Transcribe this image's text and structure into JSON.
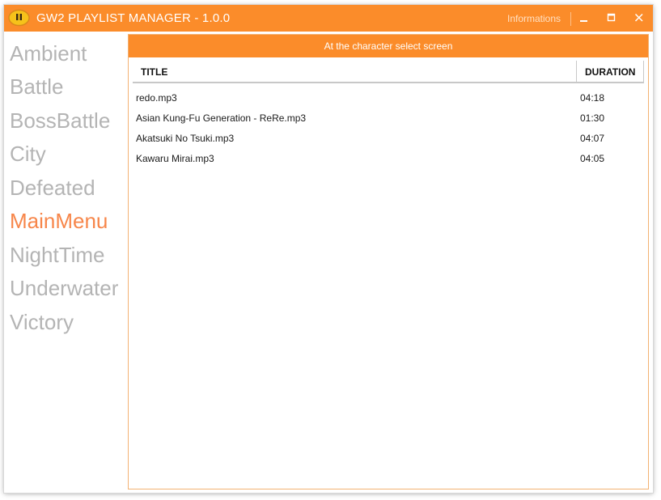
{
  "window": {
    "title": "GW2 PLAYLIST MANAGER - 1.0.0",
    "info_label": "Informations",
    "accent_color": "#fb8c2a"
  },
  "sidebar": {
    "items": [
      {
        "label": "Ambient",
        "active": false
      },
      {
        "label": "Battle",
        "active": false
      },
      {
        "label": "BossBattle",
        "active": false
      },
      {
        "label": "City",
        "active": false
      },
      {
        "label": "Defeated",
        "active": false
      },
      {
        "label": "MainMenu",
        "active": true
      },
      {
        "label": "NightTime",
        "active": false
      },
      {
        "label": "Underwater",
        "active": false
      },
      {
        "label": "Victory",
        "active": false
      }
    ]
  },
  "panel": {
    "header": "At the character select screen",
    "columns": {
      "title": "TITLE",
      "duration": "DURATION"
    },
    "tracks": [
      {
        "title": "redo.mp3",
        "duration": "04:18"
      },
      {
        "title": "Asian Kung-Fu Generation - ReRe.mp3",
        "duration": "01:30"
      },
      {
        "title": "Akatsuki No Tsuki.mp3",
        "duration": "04:07"
      },
      {
        "title": "Kawaru Mirai.mp3",
        "duration": "04:05"
      }
    ]
  },
  "icons": {
    "logo": "gw2-logo-icon",
    "minimize": "minimize-icon",
    "maximize": "maximize-icon",
    "close": "close-icon"
  }
}
